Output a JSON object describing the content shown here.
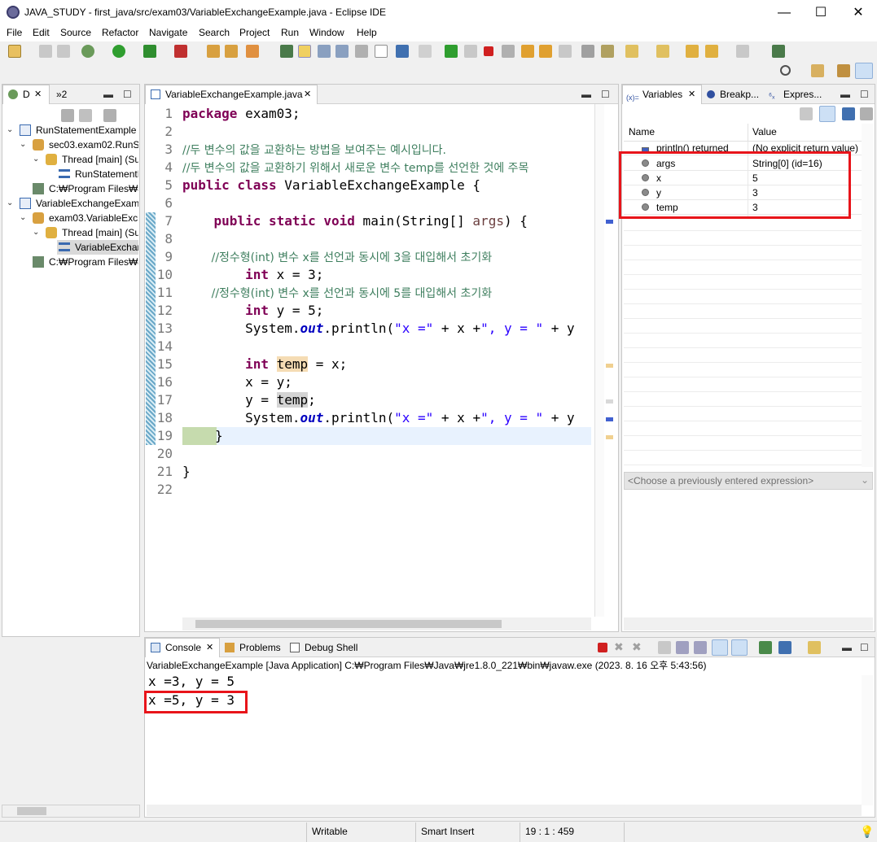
{
  "window": {
    "title": "JAVA_STUDY - first_java/src/exam03/VariableExchangeExample.java - Eclipse IDE",
    "minimize": "—",
    "maximize": "☐",
    "close": "✕"
  },
  "menu": [
    "File",
    "Edit",
    "Source",
    "Refactor",
    "Navigate",
    "Search",
    "Project",
    "Run",
    "Window",
    "Help"
  ],
  "debug_view": {
    "tab_label": "D",
    "tab_label2": "»2",
    "items": [
      {
        "label": "RunStatementExample"
      },
      {
        "label": "sec03.exam02.RunSt"
      },
      {
        "label": "Thread [main] (Su"
      },
      {
        "label": "RunStatementE"
      },
      {
        "label": "C:₩Program Files₩Ja"
      },
      {
        "label": "VariableExchangeExamp"
      },
      {
        "label": "exam03.VariableExch"
      },
      {
        "label": "Thread [main] (Su"
      },
      {
        "label": "VariableExchar"
      },
      {
        "label": "C:₩Program Files₩Ja"
      }
    ]
  },
  "editor": {
    "tab_label": "VariableExchangeExample.java",
    "line_numbers": [
      "1",
      "2",
      "3",
      "4",
      "5",
      "6",
      "7",
      "8",
      "9",
      "10",
      "11",
      "12",
      "13",
      "14",
      "15",
      "16",
      "17",
      "18",
      "19",
      "20",
      "21",
      "22"
    ],
    "lines": {
      "l1a": "package",
      "l1b": " exam03;",
      "l3": "//두 변수의 값을 교환하는 방법을 보여주는 예시입니다.",
      "l4": "//두 변수의 값을 교환하기 위해서 새로운 변수 temp를 선언한 것에 주목",
      "l5a": "public class",
      "l5b": " VariableExchangeExample {",
      "l7a": "    public static void",
      "l7b": " main(String[] ",
      "l7c": "args",
      "l7d": ") {",
      "l9": "        //정수형(int) 변수 x를 선언과 동시에 3을 대입해서 초기화",
      "l10a": "        int",
      "l10b": " x = 3;",
      "l11": "        //정수형(int) 변수 x를 선언과 동시에 5를 대입해서 초기화",
      "l12a": "        int",
      "l12b": " y = 5;",
      "l13a": "        System.",
      "l13b": "out",
      "l13c": ".println(",
      "l13d": "\"x =\"",
      "l13e": " + x +",
      "l13f": "\", y = \"",
      "l13g": " + y",
      "l15a": "        int",
      "l15b": "temp",
      "l15c": " = x;",
      "l16": "        x = y;",
      "l17a": "        y = ",
      "l17b": "temp",
      "l17c": ";",
      "l18a": "        System.",
      "l18b": "out",
      "l18c": ".println(",
      "l18d": "\"x =\"",
      "l18e": " + x +",
      "l18f": "\", y = \"",
      "l18g": " + y",
      "l19": "}",
      "l21": "}"
    }
  },
  "variables_view": {
    "tabs": [
      "Variables",
      "Breakp...",
      "Expres..."
    ],
    "columns": [
      "Name",
      "Value"
    ],
    "rows": [
      {
        "name": "println() returned",
        "value": "(No explicit return value)"
      },
      {
        "name": "args",
        "value": "String[0]  (id=16)"
      },
      {
        "name": "x",
        "value": "5"
      },
      {
        "name": "y",
        "value": "3"
      },
      {
        "name": "temp",
        "value": "3"
      }
    ],
    "expression_placeholder": "<Choose a previously entered expression>"
  },
  "console": {
    "tabs": [
      "Console",
      "Problems",
      "Debug Shell"
    ],
    "header": "VariableExchangeExample [Java Application] C:₩Program Files₩Java₩jre1.8.0_221₩bin₩javaw.exe  (2023. 8. 16 오후 5:43:56)",
    "lines": [
      "x =3, y = 5",
      "x =5, y = 3"
    ]
  },
  "status": {
    "writable": "Writable",
    "insert_mode": "Smart Insert",
    "position": "19 : 1 : 459"
  },
  "colors": {
    "highlight_box": "#e8141a",
    "keyword": "#7f0055",
    "comment": "#3f7f5f",
    "string": "#2a00ff"
  }
}
